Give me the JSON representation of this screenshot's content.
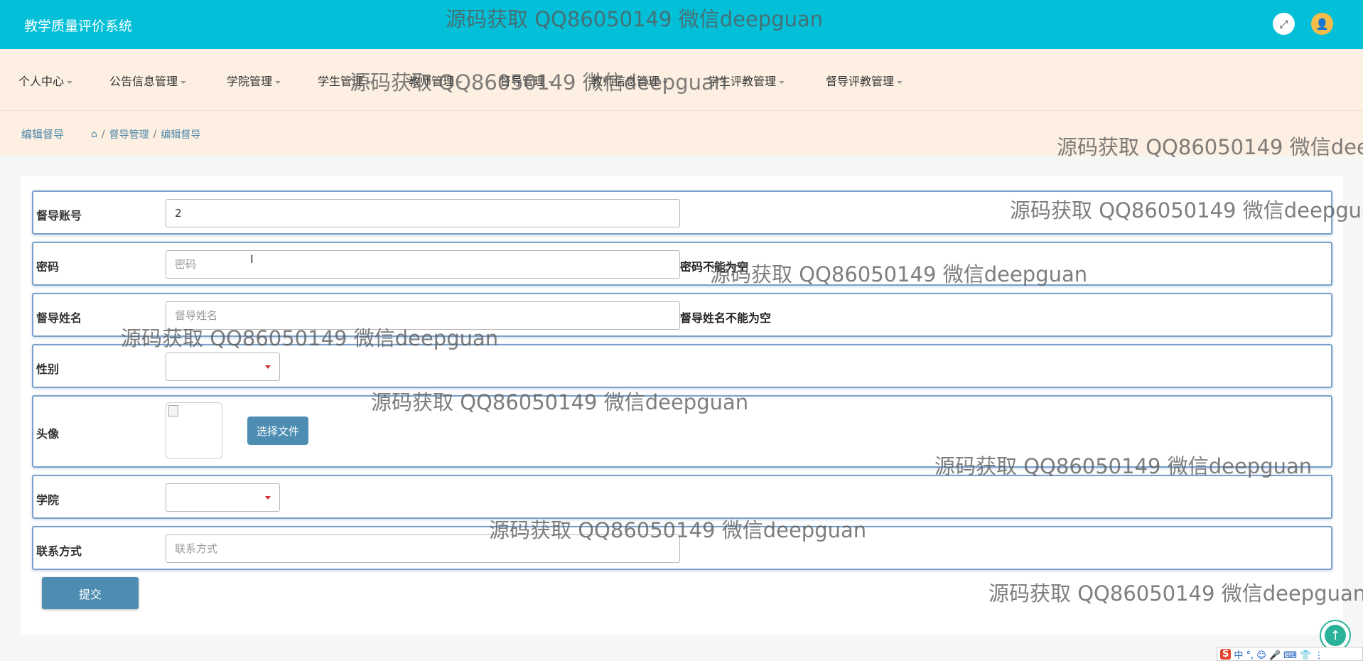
{
  "app": {
    "title": "教学质量评价系统"
  },
  "nav": {
    "items": [
      {
        "label": "个人中心"
      },
      {
        "label": "公告信息管理"
      },
      {
        "label": "学院管理"
      },
      {
        "label": "学生管理"
      },
      {
        "label": "教师管理"
      },
      {
        "label": "督导管理"
      },
      {
        "label": "教师信息管理"
      },
      {
        "label": "学生评教管理"
      },
      {
        "label": "督导评教管理"
      }
    ]
  },
  "page": {
    "title": "编辑督导",
    "breadcrumb": [
      "督导管理",
      "编辑督导"
    ],
    "breadcrumb_sep": "/"
  },
  "form": {
    "account": {
      "label": "督导账号",
      "value": "2"
    },
    "password": {
      "label": "密码",
      "placeholder": "密码",
      "hint": "密码不能为空"
    },
    "name": {
      "label": "督导姓名",
      "placeholder": "督导姓名",
      "hint": "督导姓名不能为空"
    },
    "gender": {
      "label": "性别",
      "value": ""
    },
    "avatar": {
      "label": "头像",
      "button": "选择文件"
    },
    "college": {
      "label": "学院",
      "value": ""
    },
    "contact": {
      "label": "联系方式",
      "placeholder": "联系方式"
    },
    "submit": "提交"
  },
  "watermark": "源码获取 QQ86050149 微信deepguan",
  "icons": {
    "fullscreen": "expand-icon",
    "avatar": "user-icon",
    "home": "home-icon",
    "scroll_top": "arrow-up-icon"
  },
  "ime": {
    "logo": "S",
    "text": "中 °, ☺ 🎤 ⌨ 👕 ⋮"
  },
  "colors": {
    "header": "#03c0d8",
    "navbar": "#fdf0e2",
    "button": "#4d8db2",
    "row_border": "#7aa1c9"
  }
}
